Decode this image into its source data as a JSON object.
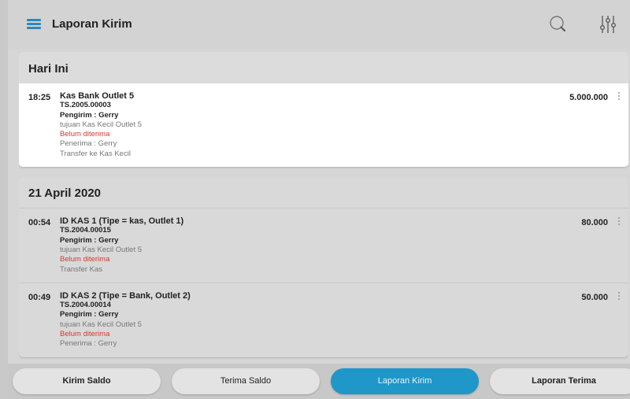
{
  "header": {
    "title": "Laporan Kirim",
    "icons": [
      "menu-icon",
      "search-icon",
      "filter-icon"
    ]
  },
  "sections": [
    {
      "title": "Hari Ini",
      "items": [
        {
          "time": "18:25",
          "name": "Kas Bank Outlet 5",
          "code": "TS.2005.00003",
          "sender": "Pengirim : Gerry",
          "destination": "tujuan Kas Kecil Outlet 5",
          "status": "Belum diterima",
          "receiver": "Penerima : Gerry",
          "note": "Transfer ke Kas Kecil",
          "amount": "5.000.000"
        }
      ]
    },
    {
      "title": "21 April 2020",
      "items": [
        {
          "time": "00:54",
          "name": "ID KAS 1 (Tipe = kas, Outlet 1)",
          "code": "TS.2004.00015",
          "sender": "Pengirim : Gerry",
          "destination": "tujuan Kas Kecil Outlet 5",
          "status": "Belum diterima",
          "note": "Transfer Kas",
          "amount": "80.000"
        },
        {
          "time": "00:49",
          "name": "ID KAS 2 (Tipe = Bank, Outlet 2)",
          "code": "TS.2004.00014",
          "sender": "Pengirim : Gerry",
          "destination": "tujuan Kas Kecil Outlet 5",
          "status": "Belum diterima",
          "receiver": "Penerima : Gerry",
          "amount": "50.000"
        }
      ]
    }
  ],
  "bottom_tabs": [
    {
      "label": "Kirim Saldo",
      "active": false
    },
    {
      "label": "Terima Saldo",
      "active": false
    },
    {
      "label": "Laporan Kirim",
      "active": true
    },
    {
      "label": "Laporan Terima",
      "active": false
    }
  ],
  "colors": {
    "accent": "#1f97c8",
    "menu_icon": "#2a8ac0",
    "status_red": "#d23a32"
  }
}
